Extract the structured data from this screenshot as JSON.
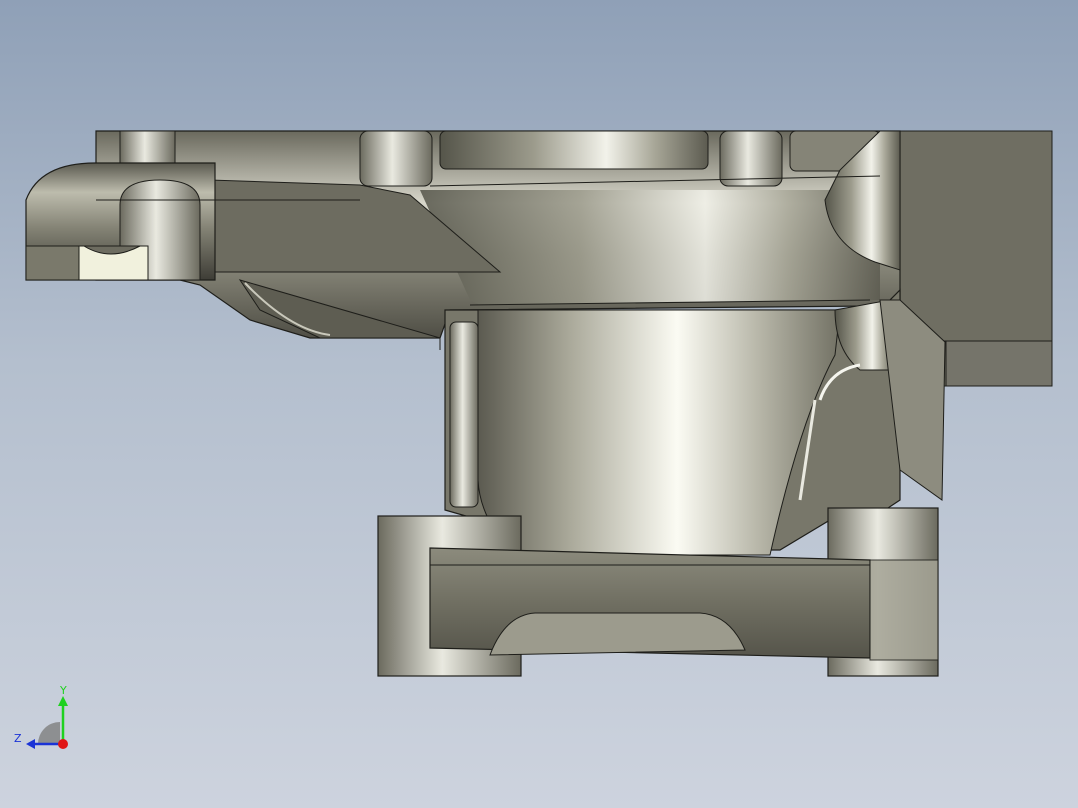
{
  "viewport": {
    "background_top": "#8fa0b7",
    "background_bottom": "#cdd3de"
  },
  "model": {
    "body_color": "#7c7a6c",
    "highlight_color": "#f2f2ea",
    "edge_color": "#1e1e1a"
  },
  "triad": {
    "y_label": "Y",
    "z_label": "Z",
    "y_color": "#1fd11f",
    "z_color": "#1b33d6",
    "x_color": "#e01515"
  }
}
